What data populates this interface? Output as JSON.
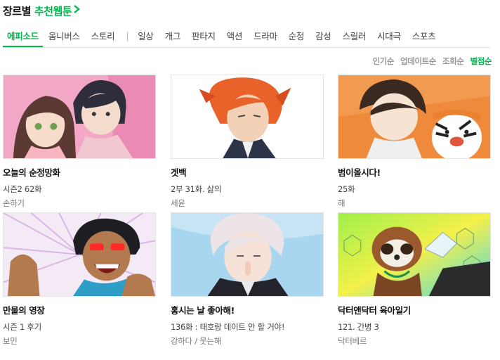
{
  "header": {
    "title": "장르별",
    "link": "추천웹툰",
    "icon": "chevron-right-icon"
  },
  "tabs": [
    {
      "label": "에피소드",
      "active": true
    },
    {
      "label": "옴니버스"
    },
    {
      "label": "스토리"
    }
  ],
  "genres": [
    "일상",
    "개그",
    "판타지",
    "액션",
    "드라마",
    "순정",
    "감성",
    "스릴러",
    "시대극",
    "스포츠"
  ],
  "sort": [
    {
      "label": "인기순"
    },
    {
      "label": "업데이트순"
    },
    {
      "label": "조회순"
    },
    {
      "label": "별점순",
      "active": true
    }
  ],
  "colors": {
    "accent": "#00b84d"
  },
  "cards": [
    {
      "title": "오늘의 순정망화",
      "episode": "시즌2 62화",
      "author": "손하기"
    },
    {
      "title": "겟백",
      "episode": "2부 31화. 삶의",
      "author": "세윤"
    },
    {
      "title": "범이올시다!",
      "episode": "25화",
      "author": "해"
    },
    {
      "title": "만물의 영장",
      "episode": "시즌 1 후기",
      "author": "보민"
    },
    {
      "title": "홍시는 날 좋아해!",
      "episode": "136화 : 태호랑 데이트 안 할 거야!",
      "author": "강하다 / 웃는해"
    },
    {
      "title": "닥터앤닥터 육아일기",
      "episode": "121. 간병 3",
      "author": "닥터베르"
    }
  ]
}
